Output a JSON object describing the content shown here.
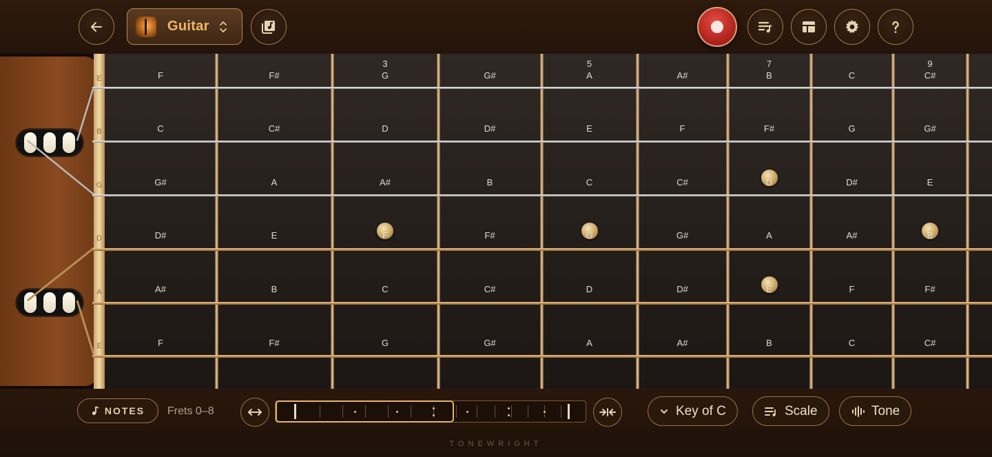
{
  "header": {
    "instrument": "Guitar",
    "icons": {
      "back": "back-arrow-icon",
      "library": "music-library-icon",
      "record": "record-icon",
      "playlist": "playlist-icon",
      "layout": "layout-icon",
      "settings": "gear-icon",
      "help": "help-icon"
    }
  },
  "fretboard": {
    "open_strings": [
      "E",
      "B",
      "G",
      "D",
      "A",
      "E"
    ],
    "fret_numbers": [
      "",
      "",
      "3",
      "",
      "5",
      "",
      "7",
      "",
      "9"
    ],
    "strings": [
      {
        "name": "E",
        "notes": [
          "F",
          "F#",
          "G",
          "G#",
          "A",
          "A#",
          "B",
          "C",
          "C#"
        ]
      },
      {
        "name": "B",
        "notes": [
          "C",
          "C#",
          "D",
          "D#",
          "E",
          "F",
          "F#",
          "G",
          "G#"
        ]
      },
      {
        "name": "G",
        "notes": [
          "G#",
          "A",
          "A#",
          "B",
          "C",
          "C#",
          "D",
          "D#",
          "E"
        ]
      },
      {
        "name": "D",
        "notes": [
          "D#",
          "E",
          "F",
          "F#",
          "G",
          "G#",
          "A",
          "A#",
          "B"
        ]
      },
      {
        "name": "A",
        "notes": [
          "A#",
          "B",
          "C",
          "C#",
          "D",
          "D#",
          "E",
          "F",
          "F#"
        ]
      },
      {
        "name": "E",
        "notes": [
          "F",
          "F#",
          "G",
          "G#",
          "A",
          "A#",
          "B",
          "C",
          "C#"
        ]
      }
    ],
    "highlighted": [
      {
        "string": 2,
        "fret": 7
      },
      {
        "string": 3,
        "fret": 3
      },
      {
        "string": 3,
        "fret": 5
      },
      {
        "string": 3,
        "fret": 9
      },
      {
        "string": 4,
        "fret": 7
      }
    ]
  },
  "footer": {
    "notes_label": "NOTES",
    "frets_range": "Frets 0–8",
    "key_label": "Key of C",
    "scale_label": "Scale",
    "tone_label": "Tone",
    "brand": "TONEWRIGHT"
  },
  "colors": {
    "accent": "#f0b866",
    "record": "#c8302a",
    "background": "#1a0f07"
  }
}
